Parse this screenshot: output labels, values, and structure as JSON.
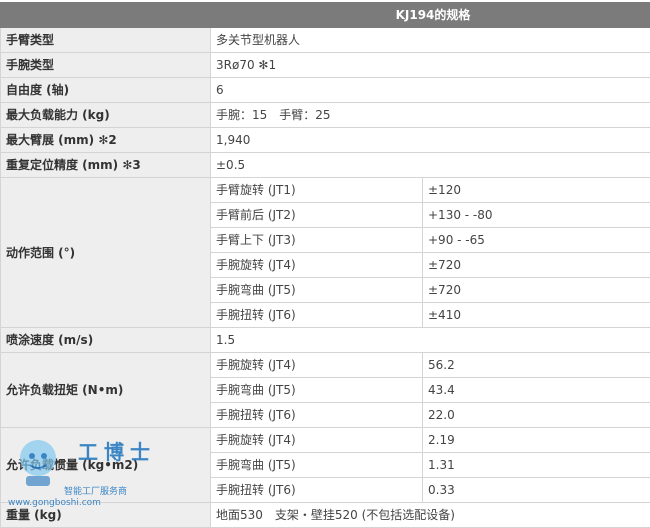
{
  "header": {
    "title": "KJ194的规格"
  },
  "rows": {
    "arm_type": {
      "label": "手臂类型",
      "value": "多关节型机器人"
    },
    "wrist_type": {
      "label": "手腕类型",
      "value": "3Rø70 ✻1"
    },
    "dof": {
      "label": "自由度 (轴)",
      "value": "6"
    },
    "max_payload": {
      "label": "最大负载能力 (kg)",
      "value": "手腕：15　手臂：25"
    },
    "max_reach": {
      "label": "最大臂展 (mm) ✻2",
      "value": "1,940"
    },
    "repeatability": {
      "label": "重复定位精度 (mm) ✻3",
      "value": "±0.5"
    },
    "motion_range": {
      "label": "动作范围 (°)",
      "items": [
        {
          "name": "手臂旋转 (JT1)",
          "value": "±120"
        },
        {
          "name": "手臂前后 (JT2)",
          "value": "+130 - -80"
        },
        {
          "name": "手臂上下 (JT3)",
          "value": "+90 - -65"
        },
        {
          "name": "手腕旋转 (JT4)",
          "value": "±720"
        },
        {
          "name": "手腕弯曲 (JT5)",
          "value": "±720"
        },
        {
          "name": "手腕扭转 (JT6)",
          "value": "±410"
        }
      ]
    },
    "spray_speed": {
      "label": "喷涂速度 (m/s)",
      "value": "1.5"
    },
    "torque": {
      "label": "允许负载扭矩 (N•m)",
      "items": [
        {
          "name": "手腕旋转 (JT4)",
          "value": "56.2"
        },
        {
          "name": "手腕弯曲 (JT5)",
          "value": "43.4"
        },
        {
          "name": "手腕扭转 (JT6)",
          "value": "22.0"
        }
      ]
    },
    "inertia": {
      "label": "允许负载惯量 (kg•m2)",
      "items": [
        {
          "name": "手腕旋转 (JT4)",
          "value": "2.19"
        },
        {
          "name": "手腕弯曲 (JT5)",
          "value": "1.31"
        },
        {
          "name": "手腕扭转 (JT6)",
          "value": "0.33"
        }
      ]
    },
    "weight": {
      "label": "重量 (kg)",
      "value": "地面530　支架・壁挂520 (不包括选配设备)"
    }
  },
  "watermark": {
    "brand": "工博士",
    "tagline": "智能工厂服务商",
    "url": "www.gongboshi.com"
  },
  "colors": {
    "header_bg": "#7b7b7b",
    "label_bg": "#eeeeee",
    "border": "#d4d4d4",
    "watermark": "#1e73be"
  }
}
